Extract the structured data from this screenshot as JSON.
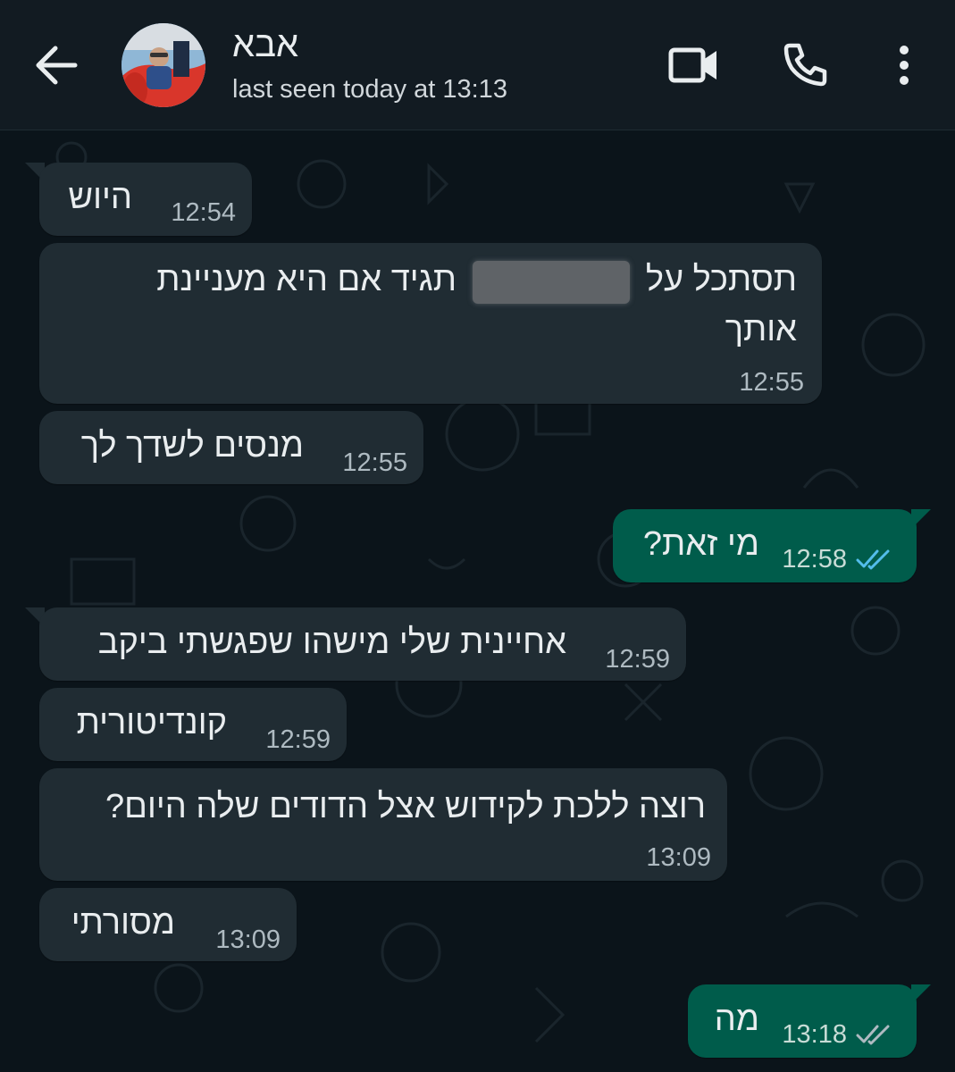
{
  "header": {
    "contact_name": "אבא",
    "last_seen": "last seen today at 13:13",
    "icons": {
      "back": "arrow-left-icon",
      "video": "video-call-icon",
      "voice": "phone-icon",
      "menu": "more-vertical-icon"
    }
  },
  "colors": {
    "header_bg": "#121b22",
    "chat_bg": "#0b141a",
    "incoming_bubble": "#202c33",
    "outgoing_bubble": "#005c4b",
    "read_tick": "#53bdeb",
    "delivered_tick": "#aebac1"
  },
  "messages": [
    {
      "direction": "in",
      "line1": "היוש",
      "time": "12:54"
    },
    {
      "direction": "in",
      "line1a": "תסתכל על",
      "line1b": "תגיד אם היא מעניינת",
      "line2": "אותך",
      "time": "12:55",
      "redacted": true
    },
    {
      "direction": "in",
      "line1": "מנסים לשדך לך",
      "time": "12:55"
    },
    {
      "direction": "out",
      "line1": "מי זאת?",
      "time": "12:58",
      "status": "read"
    },
    {
      "direction": "in",
      "line1": "אחיינית שלי מישהו שפגשתי ביקב",
      "time": "12:59"
    },
    {
      "direction": "in",
      "line1": "קונדיטורית",
      "time": "12:59"
    },
    {
      "direction": "in",
      "line1": "רוצה ללכת לקידוש אצל הדודים שלה היום?",
      "time": "13:09"
    },
    {
      "direction": "in",
      "line1": "מסורתי",
      "time": "13:09"
    },
    {
      "direction": "out",
      "line1": "מה",
      "time": "13:18",
      "status": "delivered"
    }
  ]
}
